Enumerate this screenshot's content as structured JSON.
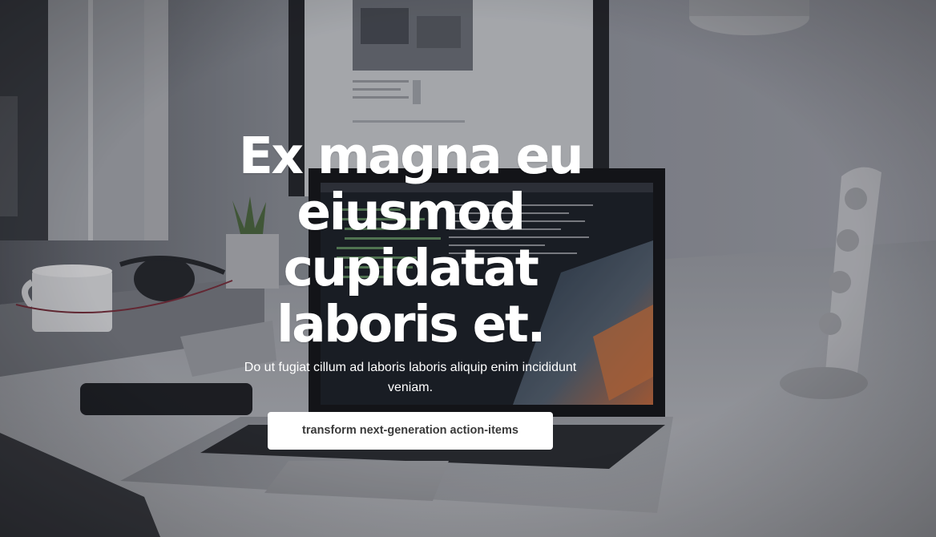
{
  "hero": {
    "headline": "Ex magna eu eiusmod cupidatat laboris et.",
    "subtext": "Do ut fugiat cillum ad laboris laboris aliquip enim incididunt veniam.",
    "cta_label": "transform next-generation action-items"
  },
  "colors": {
    "text": "#ffffff",
    "button_bg": "#ffffff",
    "button_text": "#3a3a3a"
  }
}
